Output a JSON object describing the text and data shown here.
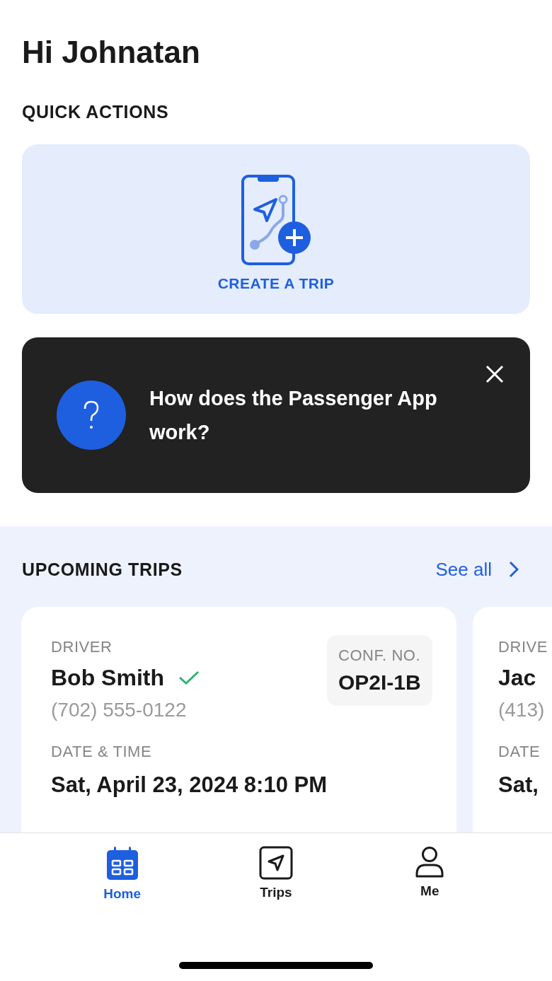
{
  "greeting": "Hi Johnatan",
  "quick_actions": {
    "title": "QUICK ACTIONS",
    "create_trip": "CREATE A TRIP"
  },
  "help_card": {
    "title": "How does the Passenger App work?"
  },
  "upcoming": {
    "title": "UPCOMING TRIPS",
    "see_all": "See all",
    "trips": [
      {
        "driver_label": "DRIVER",
        "driver": "Bob Smith",
        "verified": true,
        "phone": "(702) 555-0122",
        "date_label": "DATE & TIME",
        "date": "Sat, April 23, 2024 8:10 PM",
        "conf_label": "CONF. NO.",
        "conf": "OP2I-1B"
      },
      {
        "driver_label": "DRIVE",
        "driver": "Jac",
        "phone": "(413)",
        "date_label": "DATE",
        "date": "Sat,"
      }
    ]
  },
  "nav": [
    {
      "label": "Home",
      "selected": true
    },
    {
      "label": "Trips",
      "selected": false
    },
    {
      "label": "Me",
      "selected": false
    }
  ]
}
